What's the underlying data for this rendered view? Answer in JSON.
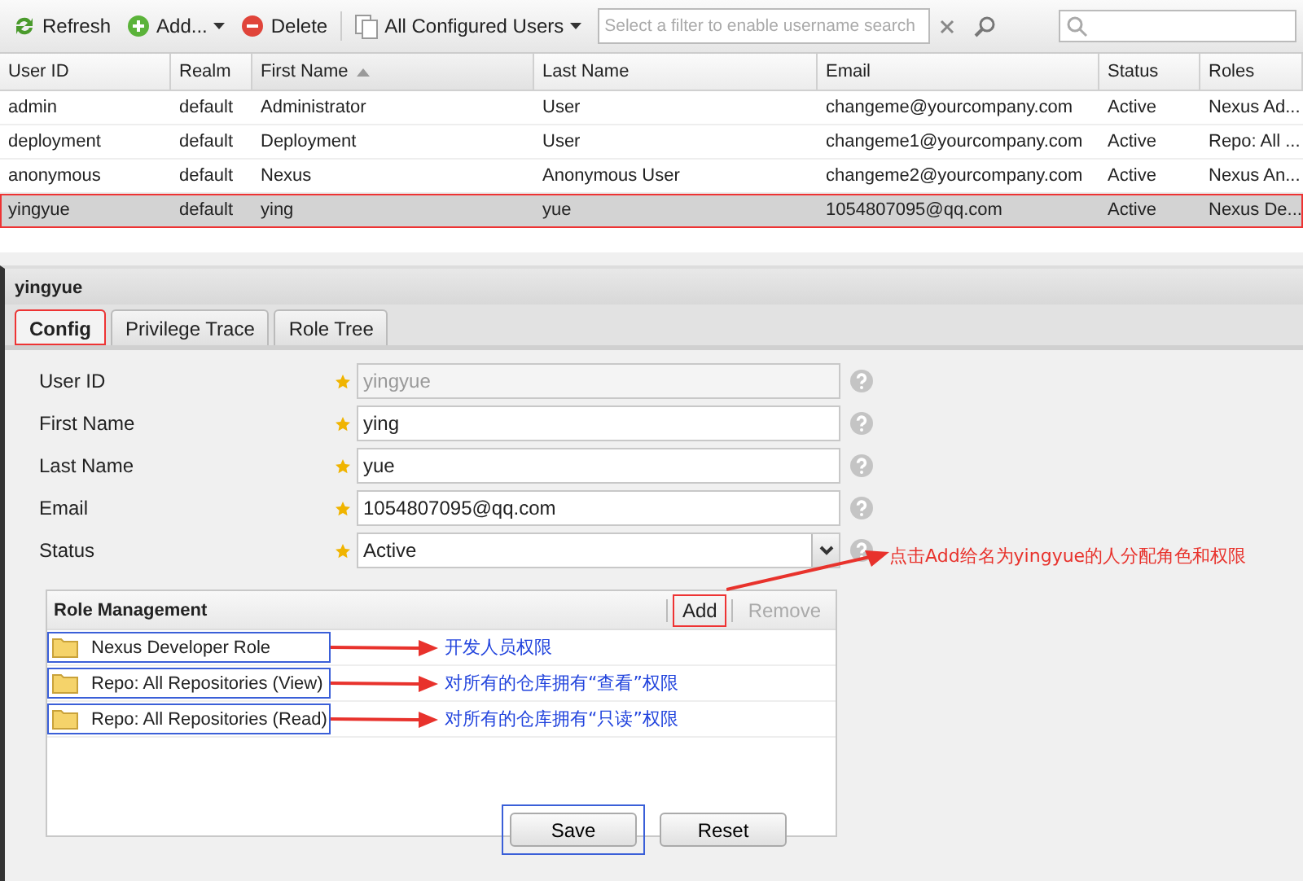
{
  "toolbar": {
    "buttons": [
      {
        "kind": "refresh",
        "label": "Refresh"
      },
      {
        "kind": "add",
        "label": "Add...",
        "menu": true
      },
      {
        "kind": "delete",
        "label": "Delete",
        "menu": false
      }
    ],
    "filter": {
      "label": "All Configured Users"
    },
    "filter_search": {
      "placeholder": "Select a filter to enable username search"
    }
  },
  "table": {
    "columns": [
      {
        "label": "User ID",
        "sorted": false
      },
      {
        "label": "Realm",
        "sorted": false
      },
      {
        "label": "First Name",
        "sorted": true
      },
      {
        "label": "Last Name",
        "sorted": false
      },
      {
        "label": "Email",
        "sorted": false
      },
      {
        "label": "Status",
        "sorted": false
      },
      {
        "label": "Roles",
        "sorted": false
      }
    ],
    "rows": [
      {
        "cells": [
          "admin",
          "default",
          "Administrator",
          "User",
          "changeme@yourcompany.com",
          "Active",
          "Nexus Ad..."
        ],
        "selected": false,
        "highlighted": false
      },
      {
        "cells": [
          "deployment",
          "default",
          "Deployment",
          "User",
          "changeme1@yourcompany.com",
          "Active",
          "Repo: All ..."
        ],
        "selected": false,
        "highlighted": false
      },
      {
        "cells": [
          "anonymous",
          "default",
          "Nexus",
          "Anonymous User",
          "changeme2@yourcompany.com",
          "Active",
          "Nexus An..."
        ],
        "selected": false,
        "highlighted": false
      },
      {
        "cells": [
          "yingyue",
          "default",
          "ying",
          "yue",
          "1054807095@qq.com",
          "Active",
          "Nexus De..."
        ],
        "selected": true,
        "highlighted": true
      }
    ]
  },
  "detail": {
    "title": "yingyue",
    "tabs": [
      {
        "label": "Config",
        "selected": true,
        "highlighted": true
      },
      {
        "label": "Privilege Trace",
        "selected": false,
        "highlighted": false
      },
      {
        "label": "Role Tree",
        "selected": false,
        "highlighted": false
      }
    ],
    "fields": [
      {
        "kind": "text",
        "label": "User ID",
        "value": "yingyue",
        "disabled": true
      },
      {
        "kind": "text",
        "label": "First Name",
        "value": "ying",
        "disabled": false
      },
      {
        "kind": "text",
        "label": "Last Name",
        "value": "yue",
        "disabled": false
      },
      {
        "kind": "text",
        "label": "Email",
        "value": "1054807095@qq.com",
        "disabled": false
      },
      {
        "kind": "select",
        "label": "Status",
        "value": "Active",
        "disabled": false
      }
    ],
    "role_management": {
      "title": "Role Management",
      "buttons": [
        {
          "label": "Add",
          "disabled": false,
          "highlighted": true
        },
        {
          "label": "Remove",
          "disabled": true,
          "highlighted": false
        }
      ],
      "roles": [
        {
          "label": "Nexus Developer Role",
          "highlighted": true,
          "note": "开发人员权限"
        },
        {
          "label": "Repo: All Repositories (View)",
          "highlighted": true,
          "note": "对所有的仓库拥有“查看”权限"
        },
        {
          "label": "Repo: All Repositories (Read)",
          "highlighted": true,
          "note": "对所有的仓库拥有“只读”权限"
        }
      ]
    },
    "buttons": [
      {
        "label": "Save",
        "highlighted": true
      },
      {
        "label": "Reset",
        "highlighted": false
      }
    ]
  },
  "add_note": "点击Add给名为yingyue的人分配角色和权限"
}
